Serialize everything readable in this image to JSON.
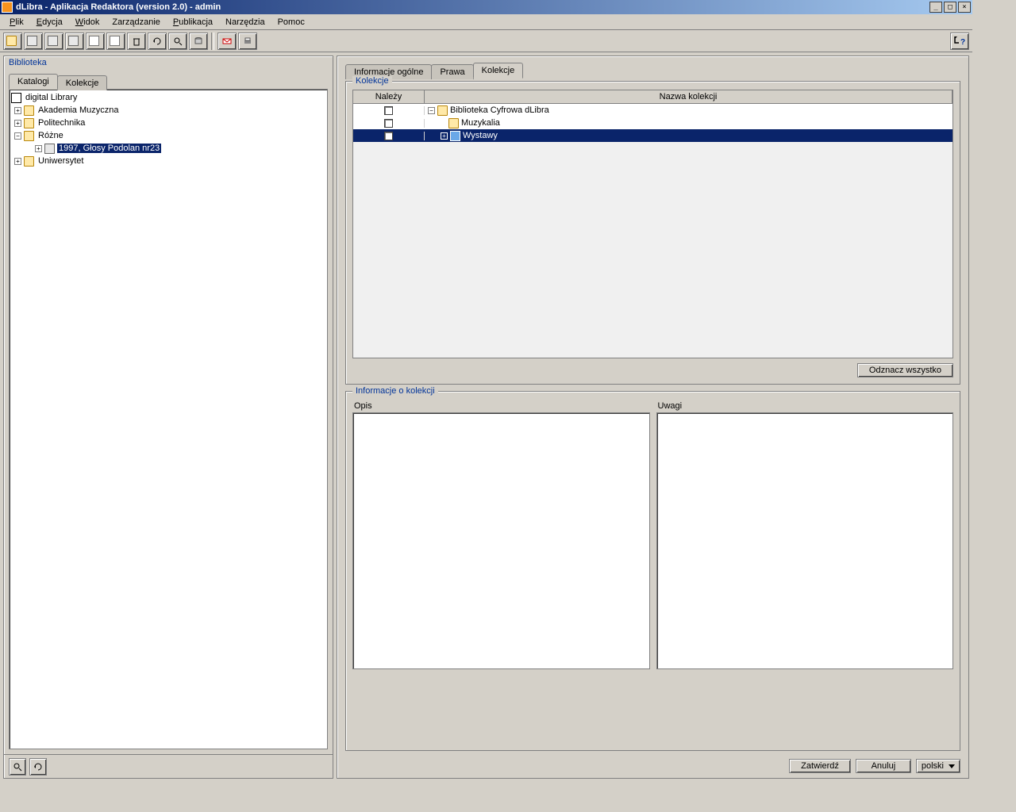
{
  "window": {
    "title": "dLibra - Aplikacja Redaktora (version 2.0) - admin"
  },
  "menu": {
    "plik": "Plik",
    "edycja": "Edycja",
    "widok": "Widok",
    "zarzadzanie": "Zarządzanie",
    "publikacja": "Publikacja",
    "narzedzia": "Narzędzia",
    "pomoc": "Pomoc"
  },
  "leftPanel": {
    "title": "Biblioteka",
    "tabs": {
      "katalogi": "Katalogi",
      "kolekcje": "Kolekcje"
    },
    "tree": {
      "root": "digital Library",
      "n1": "Akademia Muzyczna",
      "n2": "Politechnika",
      "n3": "Różne",
      "n3a": "1997, Głosy Podolan nr23",
      "n4": "Uniwersytet"
    }
  },
  "rightPanel": {
    "tabs": {
      "info": "Informacje ogólne",
      "prawa": "Prawa",
      "kolekcje": "Kolekcje"
    },
    "group1": {
      "legend": "Kolekcje",
      "headers": {
        "belongs": "Należy",
        "name": "Nazwa kolekcji"
      },
      "rows": {
        "r1": "Biblioteka Cyfrowa dLibra",
        "r2": "Muzykalia",
        "r3": "Wystawy"
      },
      "deselect": "Odznacz wszystko"
    },
    "group2": {
      "legend": "Informacje o kolekcji",
      "opis": "Opis",
      "uwagi": "Uwagi"
    }
  },
  "actions": {
    "confirm": "Zatwierdź",
    "cancel": "Anuluj",
    "lang": "polski"
  }
}
